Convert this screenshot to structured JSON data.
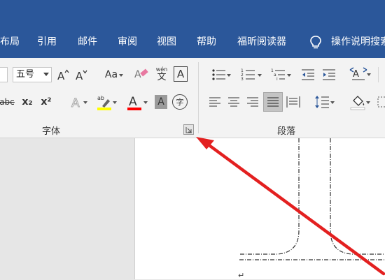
{
  "menu": {
    "tabs": [
      "布局",
      "引用",
      "邮件",
      "审阅",
      "视图",
      "帮助",
      "福昕阅读器"
    ],
    "tell_me": "操作说明搜索"
  },
  "font_group": {
    "font_size": "五号",
    "label": "字体",
    "change_case": "Aa",
    "phonetic_top": "wén",
    "phonetic_bottom": "文",
    "char_border": "A",
    "strikethrough": "abc",
    "subscript": "x₂",
    "superscript": "x²",
    "font_color_letter": "A",
    "enclose": "字",
    "highlight_letters": "ab"
  },
  "paragraph_group": {
    "label": "段落",
    "sort_icon_text": "A"
  },
  "colors": {
    "ribbon_blue": "#2b579a",
    "highlight_yellow": "#ffff00",
    "font_red": "#ff0000",
    "arrow_red": "#e32020"
  },
  "document": {
    "paragraph_mark": "↵"
  }
}
